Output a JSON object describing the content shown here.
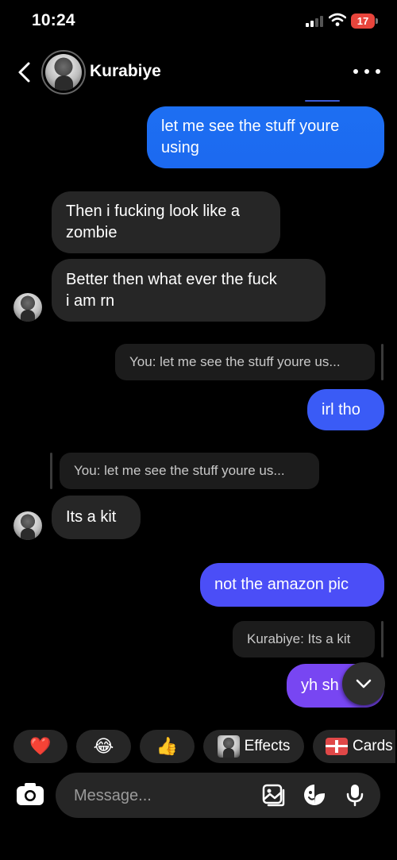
{
  "status_bar": {
    "time": "10:24",
    "battery": "17"
  },
  "header": {
    "contact_name": "Kurabiye"
  },
  "messages": [
    {
      "from": "me",
      "lines": [
        "let me see the stuff youre",
        "using"
      ]
    },
    {
      "from": "them",
      "lines": [
        "Then i fucking look like a",
        "zombie"
      ]
    },
    {
      "from": "them",
      "lines": [
        "Better then what ever the fuck",
        "i am rn"
      ]
    },
    {
      "from": "me",
      "reply_preview": "You: let me see the stuff youre us...",
      "text": "irl tho"
    },
    {
      "from": "them",
      "reply_preview": "You: let me see the stuff youre us...",
      "text": "Its a kit"
    },
    {
      "from": "me",
      "text": "not the amazon pic"
    },
    {
      "from": "me",
      "reply_preview": "Kurabiye: Its a kit",
      "text": "yh sh"
    }
  ],
  "quick_actions": {
    "heart": "❤️",
    "laugh": "😂",
    "thumbs_up": "👍",
    "effects": "Effects",
    "cards": "Cards"
  },
  "composer": {
    "placeholder": "Message..."
  },
  "colors": {
    "bubble_in": "#262626",
    "bubble_out": "#1d6ff2",
    "accent_purple": "#7846f2",
    "background": "#000000"
  }
}
